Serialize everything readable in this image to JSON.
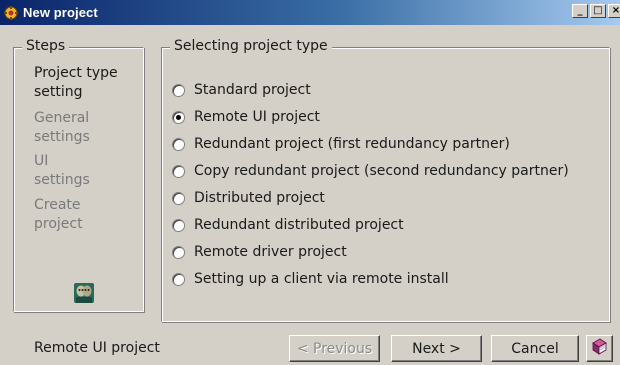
{
  "window": {
    "title": "New project",
    "minimize_glyph": "_",
    "restore_glyph": "□",
    "close_glyph": "×",
    "icon": "project-wizard-icon",
    "title_bar_color": "#0a246a"
  },
  "steps": {
    "legend": "Steps",
    "items": [
      {
        "label_line1": "Project type",
        "label_line2": "setting",
        "state": "active"
      },
      {
        "label_line1": "General",
        "label_line2": "settings",
        "state": "inactive"
      },
      {
        "label_line1": "UI",
        "label_line2": "settings",
        "state": "inactive"
      },
      {
        "label_line1": "Create",
        "label_line2": "project",
        "state": "inactive"
      }
    ],
    "avatar_icon": "users-icon"
  },
  "project_type": {
    "legend": "Selecting project type",
    "selected_index": 1,
    "options": [
      {
        "label": "Standard project",
        "checked": false
      },
      {
        "label": "Remote UI project",
        "checked": true
      },
      {
        "label": "Redundant project (first redundancy partner)",
        "checked": false
      },
      {
        "label": "Copy redundant project (second redundancy partner)",
        "checked": false
      },
      {
        "label": "Distributed project",
        "checked": false
      },
      {
        "label": "Redundant distributed project",
        "checked": false
      },
      {
        "label": "Remote driver project",
        "checked": false
      },
      {
        "label": "Setting up a client via remote install",
        "checked": false
      }
    ]
  },
  "footer": {
    "status": "Remote UI project",
    "previous_label": "< Previous",
    "next_label": "Next >",
    "cancel_label": "Cancel",
    "help_icon": "help-book-icon"
  }
}
